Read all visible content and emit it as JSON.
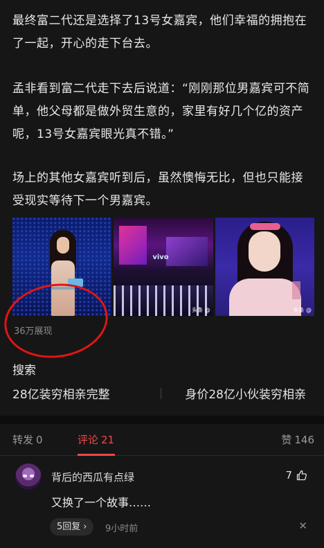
{
  "article": {
    "paragraphs": [
      "最终富二代还是选择了13号女嘉宾，他们幸福的拥抱在了一起，开心的走下台去。",
      "孟非看到富二代走下去后说道：“刚刚那位男嘉宾可不简单，他父母都是做外贸生意的，家里有好几个亿的资产呢，13号女嘉宾眼光真不错。”",
      "场上的其他女嘉宾听到后，虽然懊悔无比，但也只能接受现实等待下一个男嘉宾。"
    ],
    "image_overlays": {
      "img2_logo": "vivo",
      "img2_source": "头条 @",
      "img3_source": "头条 @"
    },
    "views": "36万展现"
  },
  "search": {
    "title": "搜索",
    "suggestions": [
      "28亿装穷相亲完整",
      "身价28亿小伙装穷相亲"
    ]
  },
  "tabs": {
    "forward_label": "转发",
    "forward_count": "0",
    "comment_label": "评论",
    "comment_count": "21",
    "like_label": "赞",
    "like_count": "146"
  },
  "comment": {
    "username": "背后的西瓜有点绿",
    "likes": "7",
    "text": "又换了一个故事……",
    "reply_label": "5回复",
    "time": "9小时前"
  },
  "colors": {
    "background": "#161616",
    "accent_red": "#f04848",
    "annotation_circle": "#e01515"
  }
}
